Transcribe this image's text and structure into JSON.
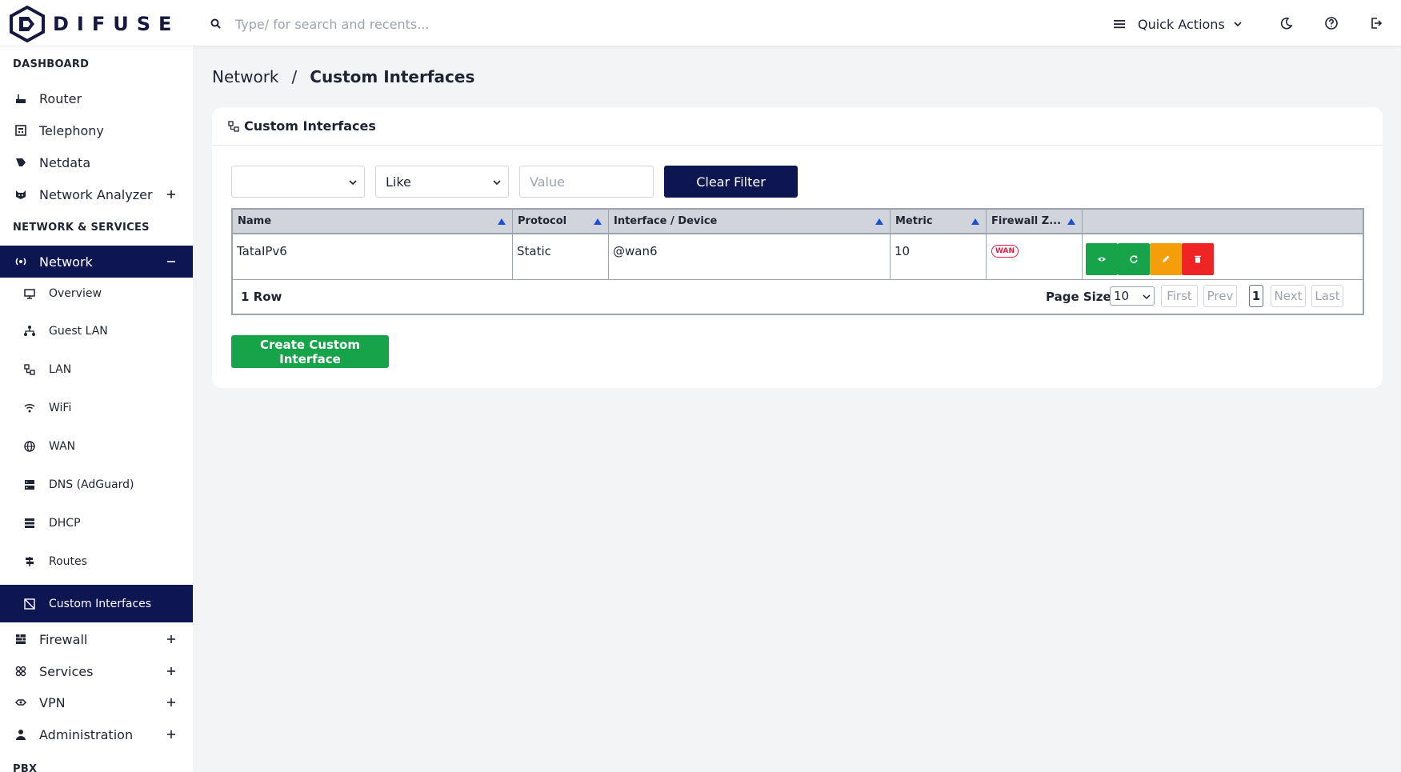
{
  "app": {
    "logo_text": "DIFUSE"
  },
  "topbar": {
    "search_placeholder": "Type/ for search and recents...",
    "quick_actions_label": "Quick Actions",
    "icons": [
      "search-icon",
      "menu-icon",
      "chevron-down-icon",
      "moon-icon",
      "help-icon",
      "logout-icon"
    ]
  },
  "sidebar": {
    "sections": {
      "dashboard": "DASHBOARD",
      "network_services": "NETWORK & SERVICES",
      "pbx": "PBX"
    },
    "dashboard_items": [
      {
        "label": "Router",
        "icon": "router-icon"
      },
      {
        "label": "Telephony",
        "icon": "telephony-icon"
      },
      {
        "label": "Netdata",
        "icon": "netdata-icon"
      },
      {
        "label": "Network Analyzer",
        "icon": "analyzer-icon",
        "expand": "+"
      }
    ],
    "network_item": {
      "label": "Network",
      "icon": "network-icon",
      "expand": "−"
    },
    "network_sub_items": [
      {
        "label": "Overview",
        "icon": "monitor-icon"
      },
      {
        "label": "Guest LAN",
        "icon": "guest-lan-icon"
      },
      {
        "label": "LAN",
        "icon": "lan-icon"
      },
      {
        "label": "WiFi",
        "icon": "wifi-icon"
      },
      {
        "label": "WAN",
        "icon": "globe-icon"
      },
      {
        "label": "DNS (AdGuard)",
        "icon": "dns-icon"
      },
      {
        "label": "DHCP",
        "icon": "dhcp-icon"
      },
      {
        "label": "Routes",
        "icon": "routes-icon"
      },
      {
        "label": "Custom Interfaces",
        "icon": "custom-interfaces-icon"
      }
    ],
    "other_items": [
      {
        "label": "Firewall",
        "icon": "firewall-icon",
        "expand": "+"
      },
      {
        "label": "Services",
        "icon": "services-icon",
        "expand": "+"
      },
      {
        "label": "VPN",
        "icon": "vpn-icon",
        "expand": "+"
      },
      {
        "label": "Administration",
        "icon": "user-icon",
        "expand": "+"
      }
    ]
  },
  "breadcrumb": {
    "parent": "Network",
    "separator": "/",
    "current": "Custom Interfaces"
  },
  "card": {
    "title": "Custom Interfaces",
    "filter": {
      "field_value": "",
      "operator_value": "Like",
      "value_placeholder": "Value",
      "clear_label": "Clear Filter"
    },
    "table": {
      "columns": [
        "Name",
        "Protocol",
        "Interface / Device",
        "Metric",
        "Firewall Z...",
        ""
      ],
      "rows": [
        {
          "name": "TataIPv6",
          "protocol": "Static",
          "interface": "@wan6",
          "metric": "10",
          "firewall_zone": "WAN"
        }
      ],
      "actions": [
        {
          "name": "view",
          "icon": "eye-icon",
          "color": "#16a34a"
        },
        {
          "name": "restart",
          "icon": "restart-icon",
          "color": "#16a34a"
        },
        {
          "name": "edit",
          "icon": "pencil-icon",
          "color": "#f59e0b"
        },
        {
          "name": "delete",
          "icon": "trash-icon",
          "color": "#ef2525"
        }
      ],
      "row_count": "1 Row",
      "page_size_label": "Page Size",
      "page_size_value": "10",
      "pager": {
        "first": "First",
        "prev": "Prev",
        "current": "1",
        "next": "Next",
        "last": "Last"
      }
    },
    "create_label": "Create Custom Interface"
  },
  "colors": {
    "primary": "#0d1650",
    "success": "#16a34a",
    "warning": "#f59e0b",
    "danger": "#ef2525"
  }
}
